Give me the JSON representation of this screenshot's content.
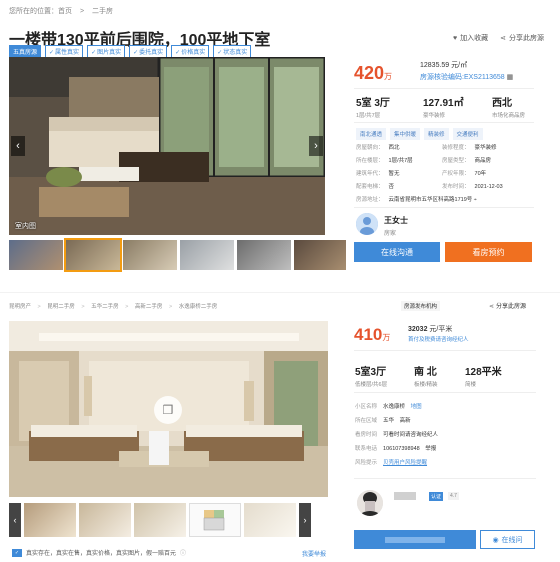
{
  "top": {
    "breadcrumb": [
      "您所在的位置：首页",
      ">",
      "二手房"
    ],
    "title": "一楼带130平前后围院，100平地下室",
    "actions": {
      "favorite": "加入收藏",
      "share": "分享此房源"
    },
    "tags": [
      "五真房源",
      "属性真实",
      "图片真实",
      "委托真实",
      "价格真实",
      "状态真实"
    ],
    "photo_label": "室内图",
    "price": {
      "value": "420",
      "unit": "万"
    },
    "unit_price": "12835.59 元/㎡",
    "listing_code": "房源核验编码:EXS2113658",
    "stats": [
      {
        "value": "5室 3厅",
        "sub": "1层/共7层"
      },
      {
        "value": "127.91㎡",
        "sub": "豪华装修"
      },
      {
        "value": "西北",
        "sub": "市场化商品房"
      }
    ],
    "chips": [
      "南北通透",
      "集中供暖",
      "精装修",
      "交通便利"
    ],
    "details": [
      {
        "label": "房屋朝向：",
        "value": "西北",
        "label2": "装修程度：",
        "value2": "豪华装修"
      },
      {
        "label": "所在楼层：",
        "value": "1层/共7层",
        "label2": "房屋类型：",
        "value2": "商品房"
      },
      {
        "label": "建筑年代：",
        "value": "暂无",
        "label2": "产权年限：",
        "value2": "70年"
      },
      {
        "label": "配套电梯：",
        "value": "否",
        "label2": "发布时间：",
        "value2": "2021-12-03"
      }
    ],
    "address": {
      "label": "房源地址：",
      "value": "云南省昆明市五华区科高路1719号"
    },
    "agent": {
      "name": "王女士",
      "role": "房家"
    },
    "buttons": {
      "chat": "在线沟通",
      "visit": "看房预约"
    }
  },
  "bottom": {
    "breadcrumb": [
      "昆明房产",
      ">",
      "昆明二手房",
      ">",
      "五华二手房",
      ">",
      "高新二手房",
      ">",
      "水逸康桥二手房"
    ],
    "badge": "房源发布机构",
    "share": "分享此房源",
    "price": {
      "value": "410",
      "unit": "万"
    },
    "unit_price": {
      "value": "32032",
      "unit": "元/平米"
    },
    "sub_note": "首付及税费请咨询经纪人",
    "stats": [
      {
        "value": "5室3厅",
        "sub": "低楼层/共6层"
      },
      {
        "value": "南 北",
        "sub": "板楼/精装"
      },
      {
        "value": "128平米",
        "sub": "简楼"
      }
    ],
    "info": [
      {
        "label": "小区名称",
        "value": "水逸康桥",
        "extra": "地图"
      },
      {
        "label": "所在区域",
        "value": "五华",
        "extra": "高新"
      },
      {
        "label": "看房时间",
        "value": "可看时间请咨询经纪人",
        "extra": ""
      },
      {
        "label": "联系电话",
        "value": "106107398948",
        "extra": "举报"
      },
      {
        "label": "风险提示",
        "value": "贝壳用户风险提醒",
        "extra": ""
      }
    ],
    "agent_badge": "认证",
    "agent_score": "4.7",
    "footer": "真实存在，真实在售，真实价格，真实图片，假一赔百元",
    "report": "我要举报",
    "buttons": {
      "call": "",
      "chat": "在线问"
    }
  },
  "colors": {
    "accent": "#3f8ad8",
    "price": "#e5532d",
    "orange": "#f07020"
  }
}
